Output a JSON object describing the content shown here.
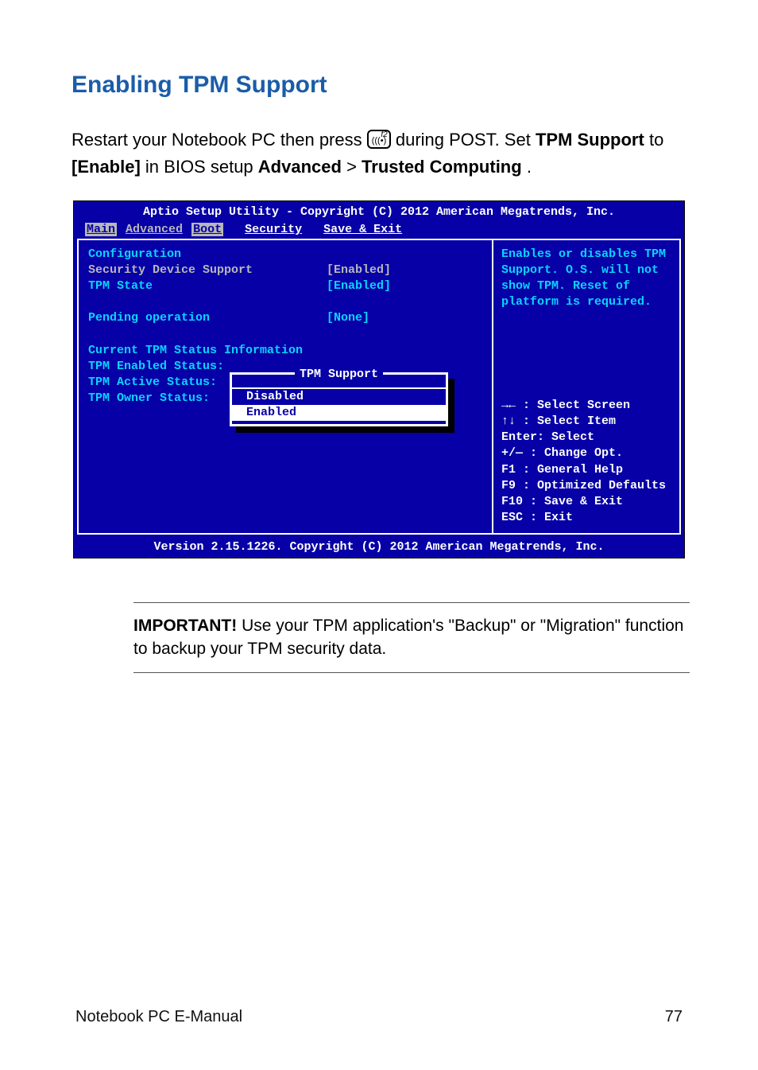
{
  "heading": "Enabling TPM Support",
  "intro": {
    "p1a": "Restart your Notebook PC then press ",
    "key_f2": "f2",
    "p1b": " during POST. Set ",
    "tpm_support": "TPM Support",
    "to": " to ",
    "enable": "[Enable]",
    "in_bios": " in BIOS setup ",
    "advanced": "Advanced",
    "gt": " > ",
    "trusted": "Trusted Computing",
    "period": "."
  },
  "bios": {
    "header": "Aptio Setup Utility - Copyright (C) 2012 American Megatrends, Inc.",
    "tabs": {
      "main": "Main",
      "advanced": "Advanced",
      "boot": "Boot",
      "security": "Security",
      "save": "Save & Exit"
    },
    "left": {
      "configuration": "Configuration",
      "security_device_support": "Security Device Support",
      "security_device_support_val": "[Enabled]",
      "tpm_state": "TPM State",
      "tpm_state_val": "[Enabled]",
      "pending_operation": "Pending operation",
      "pending_operation_val": "[None]",
      "current_status": "Current TPM Status Information",
      "tpm_enabled_status": "TPM Enabled Status:",
      "tpm_active_status": "TPM Active Status:",
      "tpm_owner_status": "TPM Owner Status:"
    },
    "popup": {
      "title": "TPM Support",
      "opt_disabled": "Disabled",
      "opt_enabled": "Enabled"
    },
    "right": {
      "help": "Enables or disables TPM Support. O.S. will not show TPM. Reset of platform is required.",
      "keys": {
        "select_screen": "→←  : Select Screen",
        "select_item": "↑↓  : Select Item",
        "enter": "Enter: Select",
        "change": "+/—  : Change Opt.",
        "f1": "F1   : General Help",
        "f9": "F9   : Optimized Defaults",
        "f10": "F10  : Save & Exit",
        "esc": "ESC  : Exit"
      }
    },
    "footer": "Version 2.15.1226. Copyright (C) 2012 American Megatrends, Inc."
  },
  "important": {
    "label": "IMPORTANT!",
    "text": " Use your TPM application's \"Backup\" or \"Migration\" function to backup your TPM security data."
  },
  "footer": {
    "left": "Notebook PC E-Manual",
    "right": "77"
  }
}
